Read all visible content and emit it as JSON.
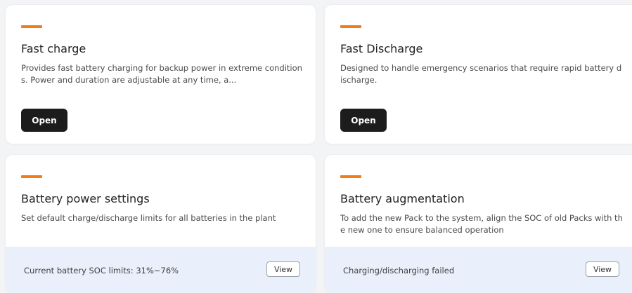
{
  "accent_color": "#f07d1a",
  "cards": [
    {
      "title": "Fast charge",
      "description": "Provides fast battery charging for backup power in extreme conditions. Power and duration are adjustable at any time, a...",
      "button_label": "Open"
    },
    {
      "title": "Fast Discharge",
      "description": "Designed to handle emergency scenarios that require rapid battery discharge.",
      "button_label": "Open"
    },
    {
      "title": "Battery power settings",
      "description": "Set default charge/discharge limits for all batteries in the plant",
      "footer_text": "Current battery SOC limits: 31%~76%",
      "button_label": "View"
    },
    {
      "title": "Battery augmentation",
      "description": "To add the new Pack to the system, align the SOC of old Packs with the new one to ensure balanced operation",
      "footer_text": "Charging/discharging failed",
      "button_label": "View"
    }
  ]
}
